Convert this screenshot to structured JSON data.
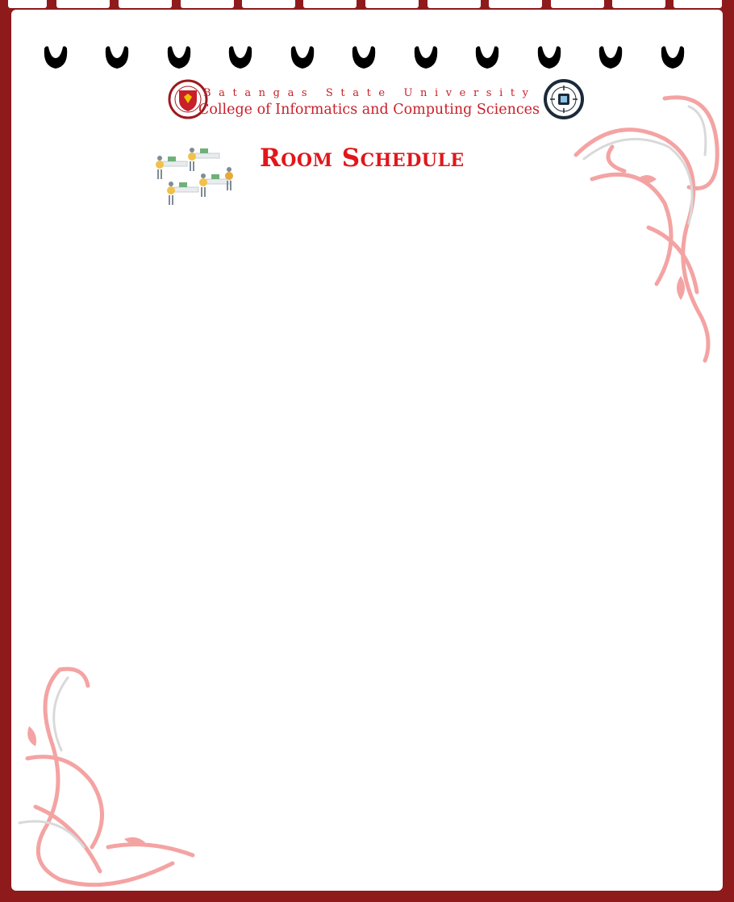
{
  "header": {
    "university": "Batangas State University",
    "college": "College of Informatics and Computing Sciences"
  },
  "page": {
    "title": "Room Schedule"
  },
  "icons": {
    "left_logo": "university-seal-icon",
    "right_logo": "college-seal-icon",
    "illustration": "people-at-desks-illustration",
    "binder_holes": "binder-hole-icon"
  },
  "colors": {
    "frame": "#8e1a1c",
    "accent_red": "#e0171b",
    "swirl_pink": "#f4a3a3"
  }
}
